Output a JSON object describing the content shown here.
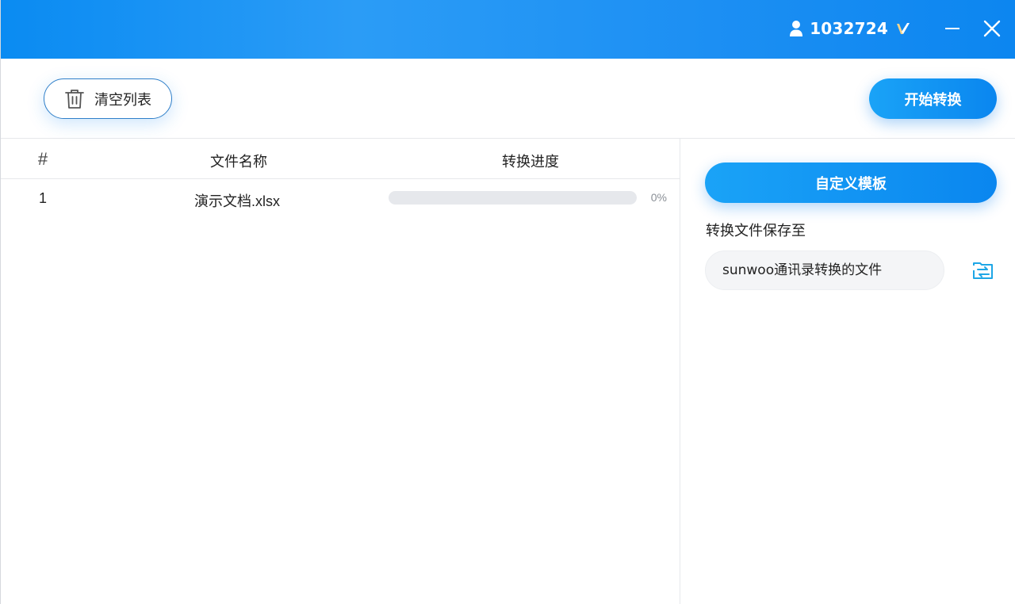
{
  "titlebar": {
    "user_id": "1032724",
    "icons": {
      "user": "user-icon",
      "vip": "vip-badge-icon",
      "minimize": "minimize-icon",
      "close": "close-icon"
    },
    "gradient": [
      "#0a8bf2",
      "#2b9cf6"
    ]
  },
  "toolbar": {
    "clear_label": "清空列表",
    "start_label": "开始转换"
  },
  "table": {
    "headers": {
      "num": "#",
      "name": "文件名称",
      "progress": "转换进度"
    },
    "rows": [
      {
        "num": "1",
        "name": "演示文档.xlsx",
        "progress_percent": 0,
        "progress_text": "0%"
      }
    ]
  },
  "settings": {
    "template_label": "自定义模板",
    "save_label": "转换文件保存至",
    "save_path": "sunwoo通讯录转换的文件"
  },
  "colors": {
    "accent": "#1890f0",
    "progress_track": "#e6e8ec",
    "path_bg": "#f4f5f7"
  }
}
